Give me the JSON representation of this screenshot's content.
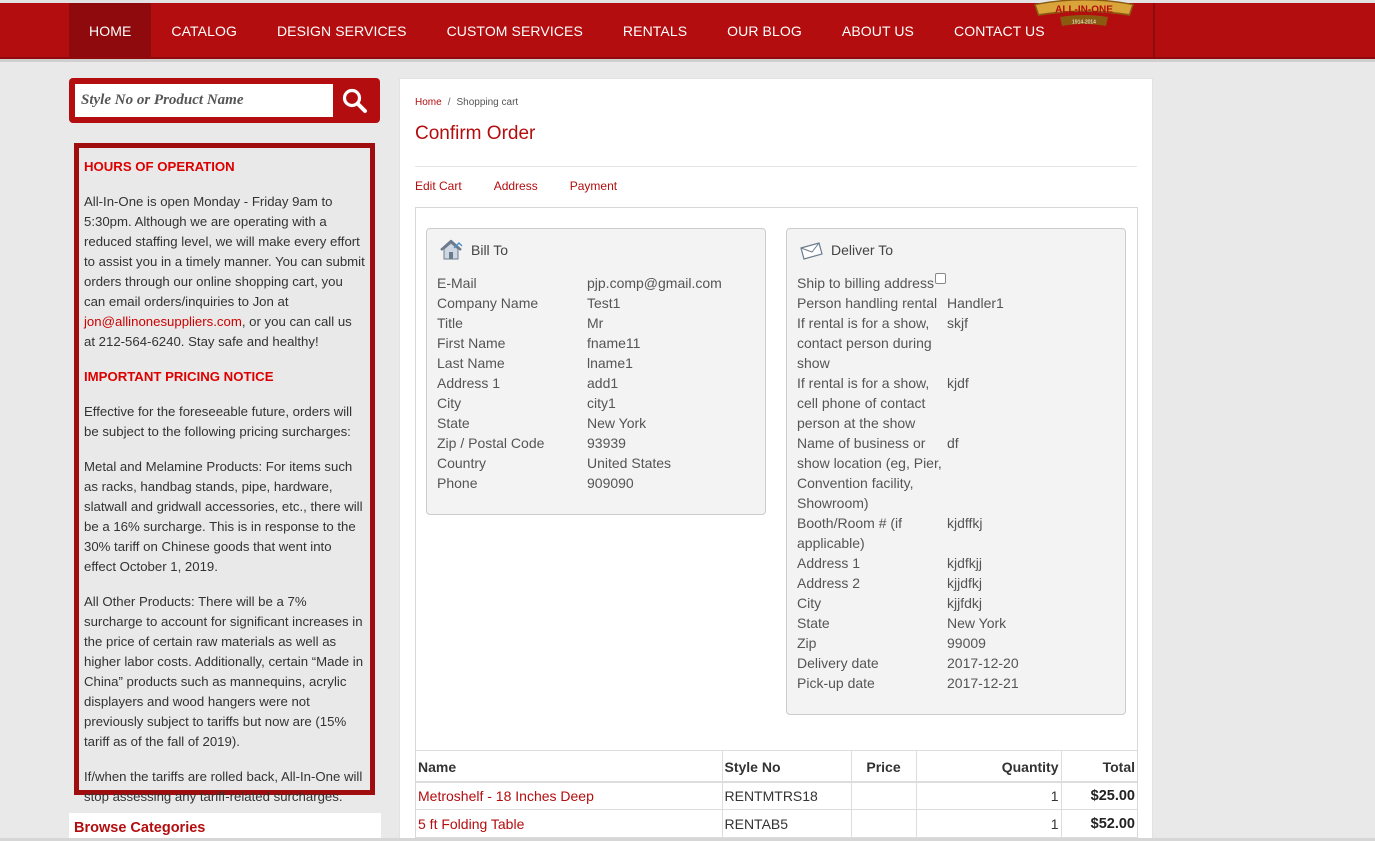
{
  "nav": {
    "items": [
      {
        "label": "HOME"
      },
      {
        "label": "CATALOG"
      },
      {
        "label": "DESIGN SERVICES"
      },
      {
        "label": "CUSTOM SERVICES"
      },
      {
        "label": "RENTALS"
      },
      {
        "label": "OUR BLOG"
      },
      {
        "label": "ABOUT US"
      },
      {
        "label": "CONTACT US"
      }
    ],
    "logo_text": "ALL-IN-ONE",
    "logo_years": "1914-2014"
  },
  "search": {
    "placeholder": "Style No or Product Name"
  },
  "notice": {
    "hours_title": "HOURS OF OPERATION",
    "hours_text_1": "All-In-One is open Monday - Friday 9am to 5:30pm. Although we are operating with a reduced staffing level, we will make every effort to assist you in a timely manner. You can submit orders through our online shopping cart, you can email orders/inquiries to Jon at ",
    "hours_email": "jon@allinonesuppliers.com",
    "hours_text_2": ", or you can call us at 212-564-6240. Stay safe and healthy!",
    "pricing_title": "IMPORTANT PRICING NOTICE",
    "pricing_p1": "Effective for the foreseeable future, orders will be subject to the following pricing surcharges:",
    "pricing_p2": "Metal and Melamine Products: For items such as racks, handbag stands, pipe, hardware, slatwall and gridwall accessories, etc., there will be a 16% surcharge. This is in response to the 30% tariff on Chinese goods that went into effect October 1, 2019.",
    "pricing_p3": "All Other Products: There will be a 7% surcharge to account for significant increases in the price of certain raw materials as well as higher labor costs. Additionally, certain “Made in China” products such as mannequins, acrylic displayers and wood hangers were not previously subject to tariffs but now are (15% tariff as of the fall of 2019).",
    "pricing_p4": "If/when the tariffs are rolled back, All-In-One will stop assessing any tariff-related surcharges."
  },
  "browse": {
    "title": "Browse Categories"
  },
  "breadcrumb": {
    "home": "Home",
    "sep": "/",
    "current": "Shopping cart"
  },
  "page_title": "Confirm Order",
  "steps": [
    {
      "label": "Edit Cart"
    },
    {
      "label": "Address"
    },
    {
      "label": "Payment"
    }
  ],
  "bill_to": {
    "title": "Bill To",
    "rows": [
      {
        "k": "E-Mail",
        "v": "pjp.comp@gmail.com"
      },
      {
        "k": "Company Name",
        "v": "Test1"
      },
      {
        "k": "Title",
        "v": "Mr"
      },
      {
        "k": "First Name",
        "v": "fname11"
      },
      {
        "k": "Last Name",
        "v": "lname1"
      },
      {
        "k": "Address 1",
        "v": "add1"
      },
      {
        "k": "City",
        "v": "city1"
      },
      {
        "k": "State",
        "v": "New York"
      },
      {
        "k": "Zip / Postal Code",
        "v": "93939"
      },
      {
        "k": "Country",
        "v": "United States"
      },
      {
        "k": "Phone",
        "v": "909090"
      }
    ]
  },
  "deliver_to": {
    "title": "Deliver To",
    "ship_label": "Ship to billing address",
    "rows": [
      {
        "k": "Person handling rental",
        "v": "Handler1"
      },
      {
        "k": "If rental is for a show, contact person during show",
        "v": "skjf"
      },
      {
        "k": "If rental is for a show, cell phone of contact person at the show",
        "v": "kjdf"
      },
      {
        "k": "Name of business or show location (eg, Pier, Convention facility, Showroom)",
        "v": "df"
      },
      {
        "k": "Booth/Room # (if applicable)",
        "v": "kjdffkj"
      },
      {
        "k": "Address 1",
        "v": "kjdfkjj"
      },
      {
        "k": "Address 2",
        "v": "kjjdfkj"
      },
      {
        "k": "City",
        "v": "kjjfdkj"
      },
      {
        "k": "State",
        "v": "New York"
      },
      {
        "k": "Zip",
        "v": "99009"
      },
      {
        "k": "Delivery date",
        "v": "2017-12-20"
      },
      {
        "k": "Pick-up date",
        "v": "2017-12-21"
      }
    ]
  },
  "table": {
    "headers": {
      "name": "Name",
      "style": "Style No",
      "price": "Price",
      "qty": "Quantity",
      "total": "Total"
    },
    "rows": [
      {
        "name": "Metroshelf - 18 Inches Deep",
        "style": "RENTMTRS18",
        "price": "",
        "qty": "1",
        "total": "$25.00"
      },
      {
        "name": "5 ft Folding Table",
        "style": "RENTAB5",
        "price": "",
        "qty": "1",
        "total": "$52.00"
      }
    ]
  },
  "colors": {
    "brand_red": "#b30d0f",
    "dark_red": "#8f0a0c",
    "notice_title_red": "#dd0000"
  }
}
